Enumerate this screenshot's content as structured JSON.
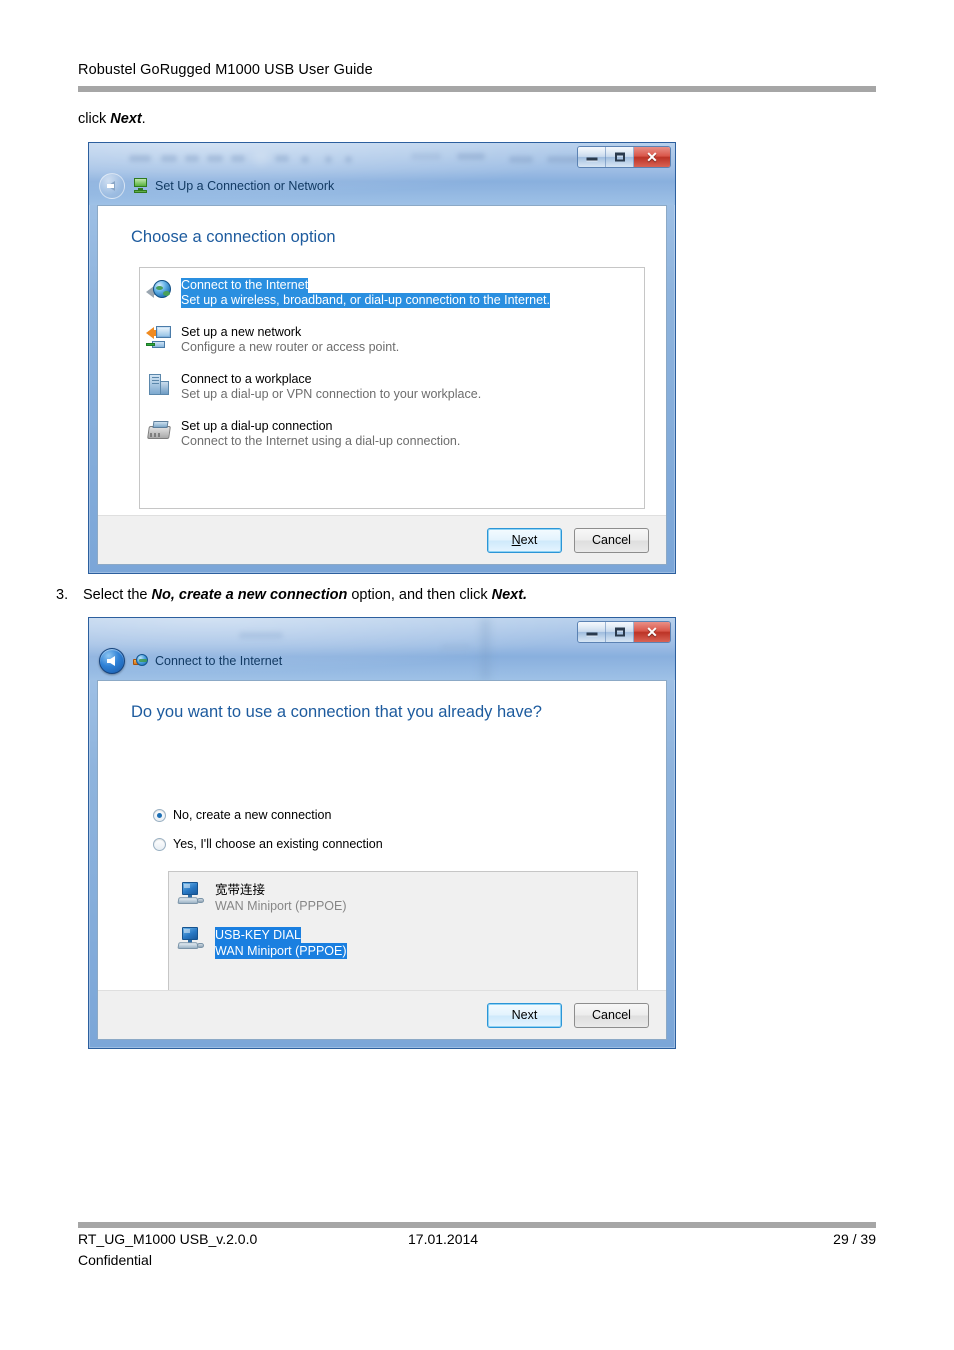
{
  "document": {
    "header_title": "Robustel GoRugged M1000 USB User Guide",
    "step_2_tail": "click ",
    "step_2_bold": "Next",
    "step_2_period": ".",
    "step_3_number": "3.",
    "step_3_pre": "Select the ",
    "step_3_bold1": "No, create a new connection",
    "step_3_mid": " option, and then click ",
    "step_3_bold2": "Next.",
    "footer_doc_id": "RT_UG_M1000 USB_v.2.0.0",
    "footer_date": "17.01.2014",
    "footer_page": "29 / 39",
    "footer_confidential": "Confidential"
  },
  "dialog1": {
    "title": "Set Up a Connection or Network",
    "title_icon": "network-setup-icon",
    "back_icon": "back-arrow-icon",
    "window_controls": {
      "minimize": "minimize-icon",
      "maximize": "maximize-icon",
      "close": "close-icon",
      "close_glyph": "✕"
    },
    "page_title": "Choose a connection option",
    "options": [
      {
        "icon": "globe-connect-icon",
        "title": "Connect to the Internet",
        "description": "Set up a wireless, broadband, or dial-up connection to the Internet.",
        "selected": true
      },
      {
        "icon": "new-network-icon",
        "title": "Set up a new network",
        "description": "Configure a new router or access point.",
        "selected": false
      },
      {
        "icon": "workplace-icon",
        "title": "Connect to a workplace",
        "description": "Set up a dial-up or VPN connection to your workplace.",
        "selected": false
      },
      {
        "icon": "dialup-modem-icon",
        "title": "Set up a dial-up connection",
        "description": "Connect to the Internet using a dial-up connection.",
        "selected": false
      }
    ],
    "buttons": {
      "next_prefix": "N",
      "next_rest": "ext",
      "cancel": "Cancel"
    }
  },
  "dialog2": {
    "title": "Connect to the Internet",
    "title_icon": "globe-plug-icon",
    "back_icon": "back-arrow-icon",
    "window_controls": {
      "minimize": "minimize-icon",
      "maximize": "maximize-icon",
      "close": "close-icon",
      "close_glyph": "✕"
    },
    "page_title": "Do you want to use a connection that you already have?",
    "radios": [
      {
        "label": "No, create a new connection",
        "checked": true
      },
      {
        "label": "Yes, I'll choose an existing connection",
        "checked": false
      }
    ],
    "connections": [
      {
        "icon": "computer-connection-icon",
        "name": "宽带连接",
        "device": "WAN Miniport (PPPOE)",
        "selected": false
      },
      {
        "icon": "computer-connection-icon",
        "name": "USB-KEY DIAL",
        "device": "WAN Miniport (PPPOE)",
        "selected": true
      }
    ],
    "buttons": {
      "next": "Next",
      "cancel": "Cancel"
    }
  },
  "colors": {
    "selection_blue": "#1a7fe0",
    "title_blue": "#1d5b9e",
    "rule_gray": "#a6a6a6",
    "close_red": "#bc3326"
  }
}
